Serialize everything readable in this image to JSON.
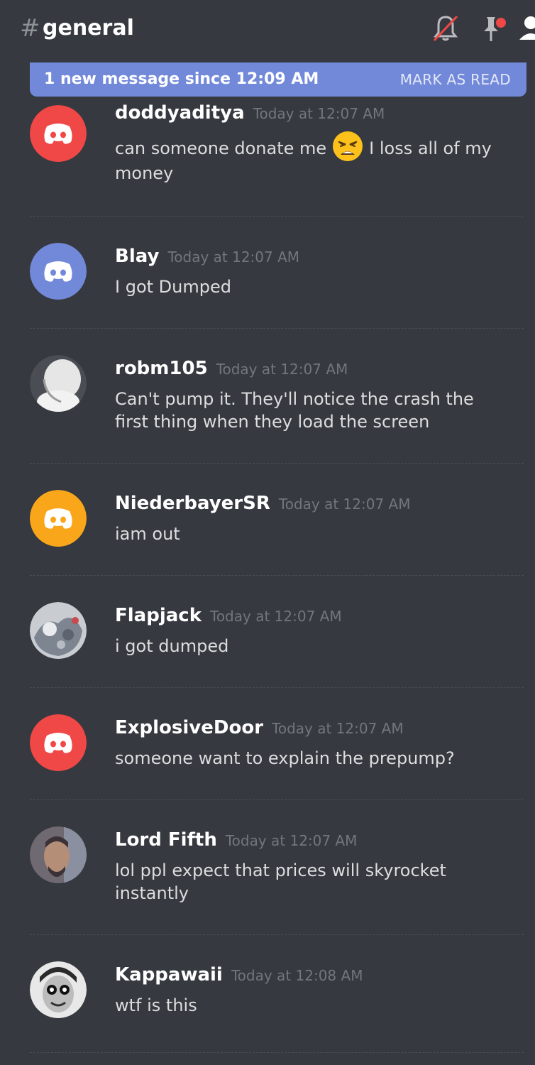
{
  "header": {
    "hash": "#",
    "channel": "general",
    "icons": [
      "mute-bell-icon",
      "pin-icon",
      "members-icon"
    ]
  },
  "banner": {
    "text": "1 new message since 12:09 AM",
    "action": "MARK AS READ"
  },
  "messages": [
    {
      "user": "doddyaditya",
      "time": "Today at 12:07 AM",
      "text_before": "can someone donate me",
      "emoji": "weary-face-emoji",
      "text_after": "I loss all of my money",
      "avatar": "discord-logo-red"
    },
    {
      "user": "Blay",
      "time": "Today at 12:07 AM",
      "text": "I got Dumped",
      "avatar": "discord-logo-blurple"
    },
    {
      "user": "robm105",
      "time": "Today at 12:07 AM",
      "text": "Can't pump it. They'll notice the crash the first thing when they load the screen",
      "avatar": "photo-avatar"
    },
    {
      "user": "NiederbayerSR",
      "time": "Today at 12:07 AM",
      "text": "iam out",
      "avatar": "discord-logo-yellow"
    },
    {
      "user": "Flapjack",
      "time": "Today at 12:07 AM",
      "text": "i got dumped",
      "avatar": "photo-avatar"
    },
    {
      "user": "ExplosiveDoor",
      "time": "Today at 12:07 AM",
      "text": "someone want to explain the prepump?",
      "avatar": "discord-logo-red"
    },
    {
      "user": "Lord Fifth",
      "time": "Today at 12:07 AM",
      "text": "lol ppl expect that prices will skyrocket instantly",
      "avatar": "photo-avatar"
    },
    {
      "user": "Kappawaii",
      "time": "Today at 12:08 AM",
      "text": "wtf is this",
      "avatar": "photo-avatar"
    }
  ],
  "colors": {
    "background": "#36393f",
    "banner": "#7289da",
    "discord_red": "#f04747",
    "discord_blurple": "#7289da",
    "discord_yellow": "#faa61a",
    "notification_dot": "#f04747"
  }
}
